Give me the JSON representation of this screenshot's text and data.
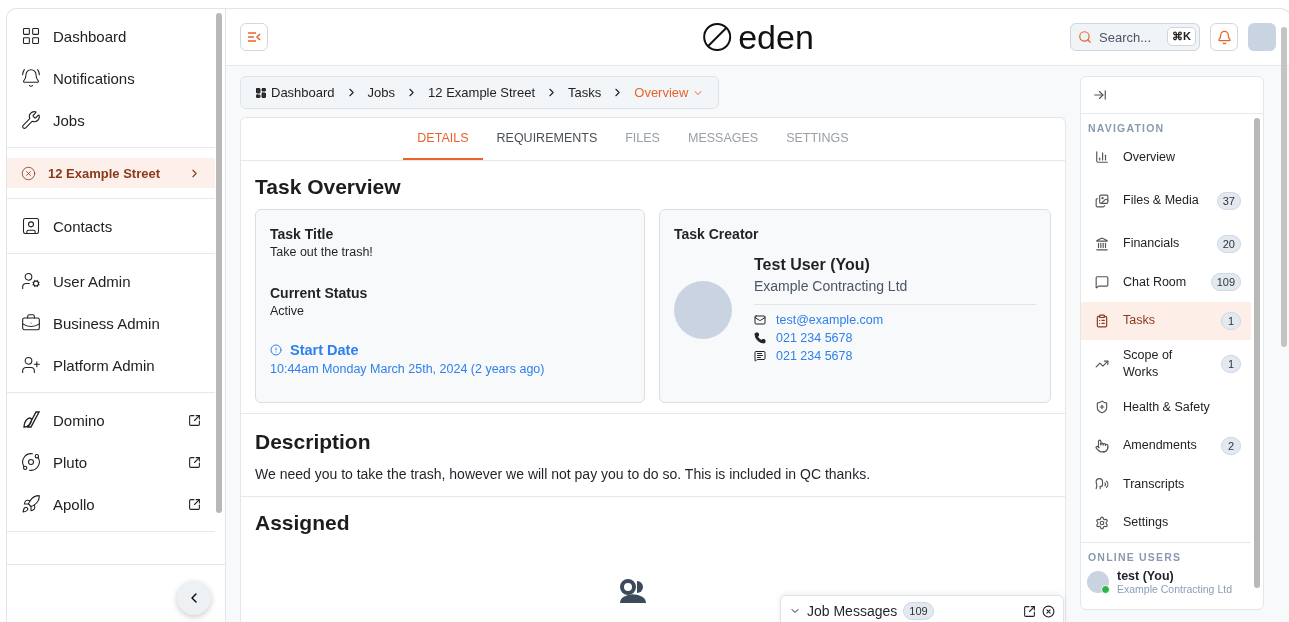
{
  "sidebar": {
    "sections": [
      [
        {
          "label": "Dashboard",
          "kind": "link",
          "selected": false
        },
        {
          "label": "Notifications",
          "kind": "link",
          "selected": false
        },
        {
          "label": "Jobs",
          "kind": "link",
          "selected": false
        }
      ],
      [
        {
          "label": "12 Example Street",
          "kind": "job",
          "selected": true
        }
      ],
      [
        {
          "label": "Contacts",
          "kind": "link",
          "selected": false
        }
      ],
      [
        {
          "label": "User Admin",
          "kind": "link",
          "selected": false
        },
        {
          "label": "Business Admin",
          "kind": "link",
          "selected": false
        },
        {
          "label": "Platform Admin",
          "kind": "link",
          "selected": false
        }
      ],
      [
        {
          "label": "Domino",
          "kind": "external",
          "selected": false
        },
        {
          "label": "Pluto",
          "kind": "external",
          "selected": false
        },
        {
          "label": "Apollo",
          "kind": "external",
          "selected": false
        }
      ]
    ]
  },
  "header": {
    "logo": "eden",
    "search": {
      "placeholder": "Search...",
      "shortcut": "⌘K"
    }
  },
  "breadcrumbs": [
    {
      "label": "Dashboard",
      "current": false
    },
    {
      "label": "Jobs",
      "current": false
    },
    {
      "label": "12 Example Street",
      "current": false
    },
    {
      "label": "Tasks",
      "current": false
    },
    {
      "label": "Overview",
      "current": true
    }
  ],
  "tabs": [
    {
      "label": "DETAILS",
      "selected": true,
      "disabled": false
    },
    {
      "label": "REQUIREMENTS",
      "selected": false,
      "disabled": false
    },
    {
      "label": "FILES",
      "selected": false,
      "disabled": true
    },
    {
      "label": "MESSAGES",
      "selected": false,
      "disabled": true
    },
    {
      "label": "SETTINGS",
      "selected": false,
      "disabled": true
    }
  ],
  "overview": {
    "title": "Task Overview",
    "fields": [
      {
        "label": "Task Title",
        "value": "Take out the trash!"
      },
      {
        "label": "Current Status",
        "value": "Active"
      }
    ],
    "start_date": {
      "label": "Start Date",
      "value": "10:44am Monday March 25th, 2024 (2 years ago)"
    },
    "creator": {
      "heading": "Task Creator",
      "name": "Test User (You)",
      "company": "Example Contracting Ltd",
      "email": "test@example.com",
      "phone": "021 234 5678",
      "sms": "021 234 5678"
    }
  },
  "description": {
    "title": "Description",
    "text": "We need you to take the trash, however we will not pay you to do so. This is included in QC thanks."
  },
  "assigned": {
    "title": "Assigned"
  },
  "right_panel": {
    "nav_heading": "NAVIGATION",
    "items": [
      {
        "label": "Overview",
        "selected": false
      },
      {
        "label": "Files & Media",
        "count": "37",
        "selected": false
      },
      {
        "label": "Financials",
        "count": "20",
        "selected": false
      },
      {
        "label": "Chat Room",
        "count": "109",
        "selected": false
      },
      {
        "label": "Tasks",
        "count": "1",
        "selected": true
      },
      {
        "label": "Scope of Works",
        "count": "1",
        "selected": false
      },
      {
        "label": "Health & Safety",
        "selected": false
      },
      {
        "label": "Amendments",
        "count": "2",
        "selected": false
      },
      {
        "label": "Transcripts",
        "selected": false
      },
      {
        "label": "Settings",
        "selected": false
      }
    ],
    "online_heading": "ONLINE USERS",
    "online_users": [
      {
        "name": "test (You)",
        "company": "Example Contracting Ltd",
        "online": true
      }
    ]
  },
  "job_messages": {
    "title": "Job Messages",
    "count": "109"
  }
}
